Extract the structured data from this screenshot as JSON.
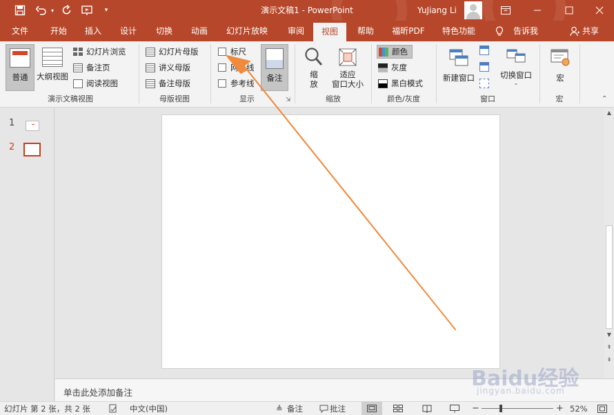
{
  "titlebar": {
    "document_title": "演示文稿1  -  PowerPoint",
    "user": "YuJiang Li",
    "more_symbol": "⋯"
  },
  "tabs": [
    {
      "label": "文件"
    },
    {
      "label": "开始"
    },
    {
      "label": "插入"
    },
    {
      "label": "设计"
    },
    {
      "label": "切换"
    },
    {
      "label": "动画"
    },
    {
      "label": "幻灯片放映"
    },
    {
      "label": "审阅"
    },
    {
      "label": "视图",
      "active": true
    },
    {
      "label": "帮助"
    },
    {
      "label": "福昕PDF"
    },
    {
      "label": "特色功能"
    }
  ],
  "tell_me": "告诉我",
  "share": "共享",
  "ribbon": {
    "presentation_views": {
      "label": "演示文稿视图",
      "normal": "普通",
      "outline": "大纲视图",
      "slide_sorter": "幻灯片浏览",
      "notes_page": "备注页",
      "reading_view": "阅读视图"
    },
    "master_views": {
      "label": "母版视图",
      "slide_master": "幻灯片母版",
      "handout_master": "讲义母版",
      "notes_master": "备注母版"
    },
    "show": {
      "label": "显示",
      "ruler": "标尺",
      "gridlines": "网格线",
      "guides": "参考线",
      "notes": "备注"
    },
    "zoom": {
      "label": "缩放",
      "zoom_line1": "缩",
      "zoom_line2": "放",
      "fit_line1": "适应",
      "fit_line2": "窗口大小"
    },
    "color": {
      "label": "颜色/灰度",
      "color": "颜色",
      "grayscale": "灰度",
      "bw": "黑白模式"
    },
    "window": {
      "label": "窗口",
      "new_window": "新建窗口",
      "switch_window": "切换窗口"
    },
    "macros": {
      "label": "宏",
      "macros": "宏"
    }
  },
  "thumbnails": [
    {
      "number": "1"
    },
    {
      "number": "2",
      "current": true
    }
  ],
  "notes_placeholder": "单击此处添加备注",
  "status": {
    "slide_info": "幻灯片 第 2 张，共 2 张",
    "language": "中文(中国)",
    "notes": "备注",
    "comments": "批注",
    "zoom_minus": "−",
    "zoom_plus": "+",
    "zoom_level": "52%",
    "zoom_fraction": 0.52
  },
  "watermark": {
    "brand": "Baidu经验",
    "url": "jingyan.baidu.com"
  },
  "colors": {
    "accent": "#b7472a",
    "annotation_arrow": "#f08a3c"
  },
  "icons": [
    "save-icon",
    "undo-icon",
    "redo-icon",
    "present-from-start-icon",
    "customize-quick-access-icon",
    "ribbon-display-options-icon",
    "minimize-icon",
    "maximize-icon",
    "close-icon",
    "lightbulb-icon",
    "share-person-icon"
  ]
}
